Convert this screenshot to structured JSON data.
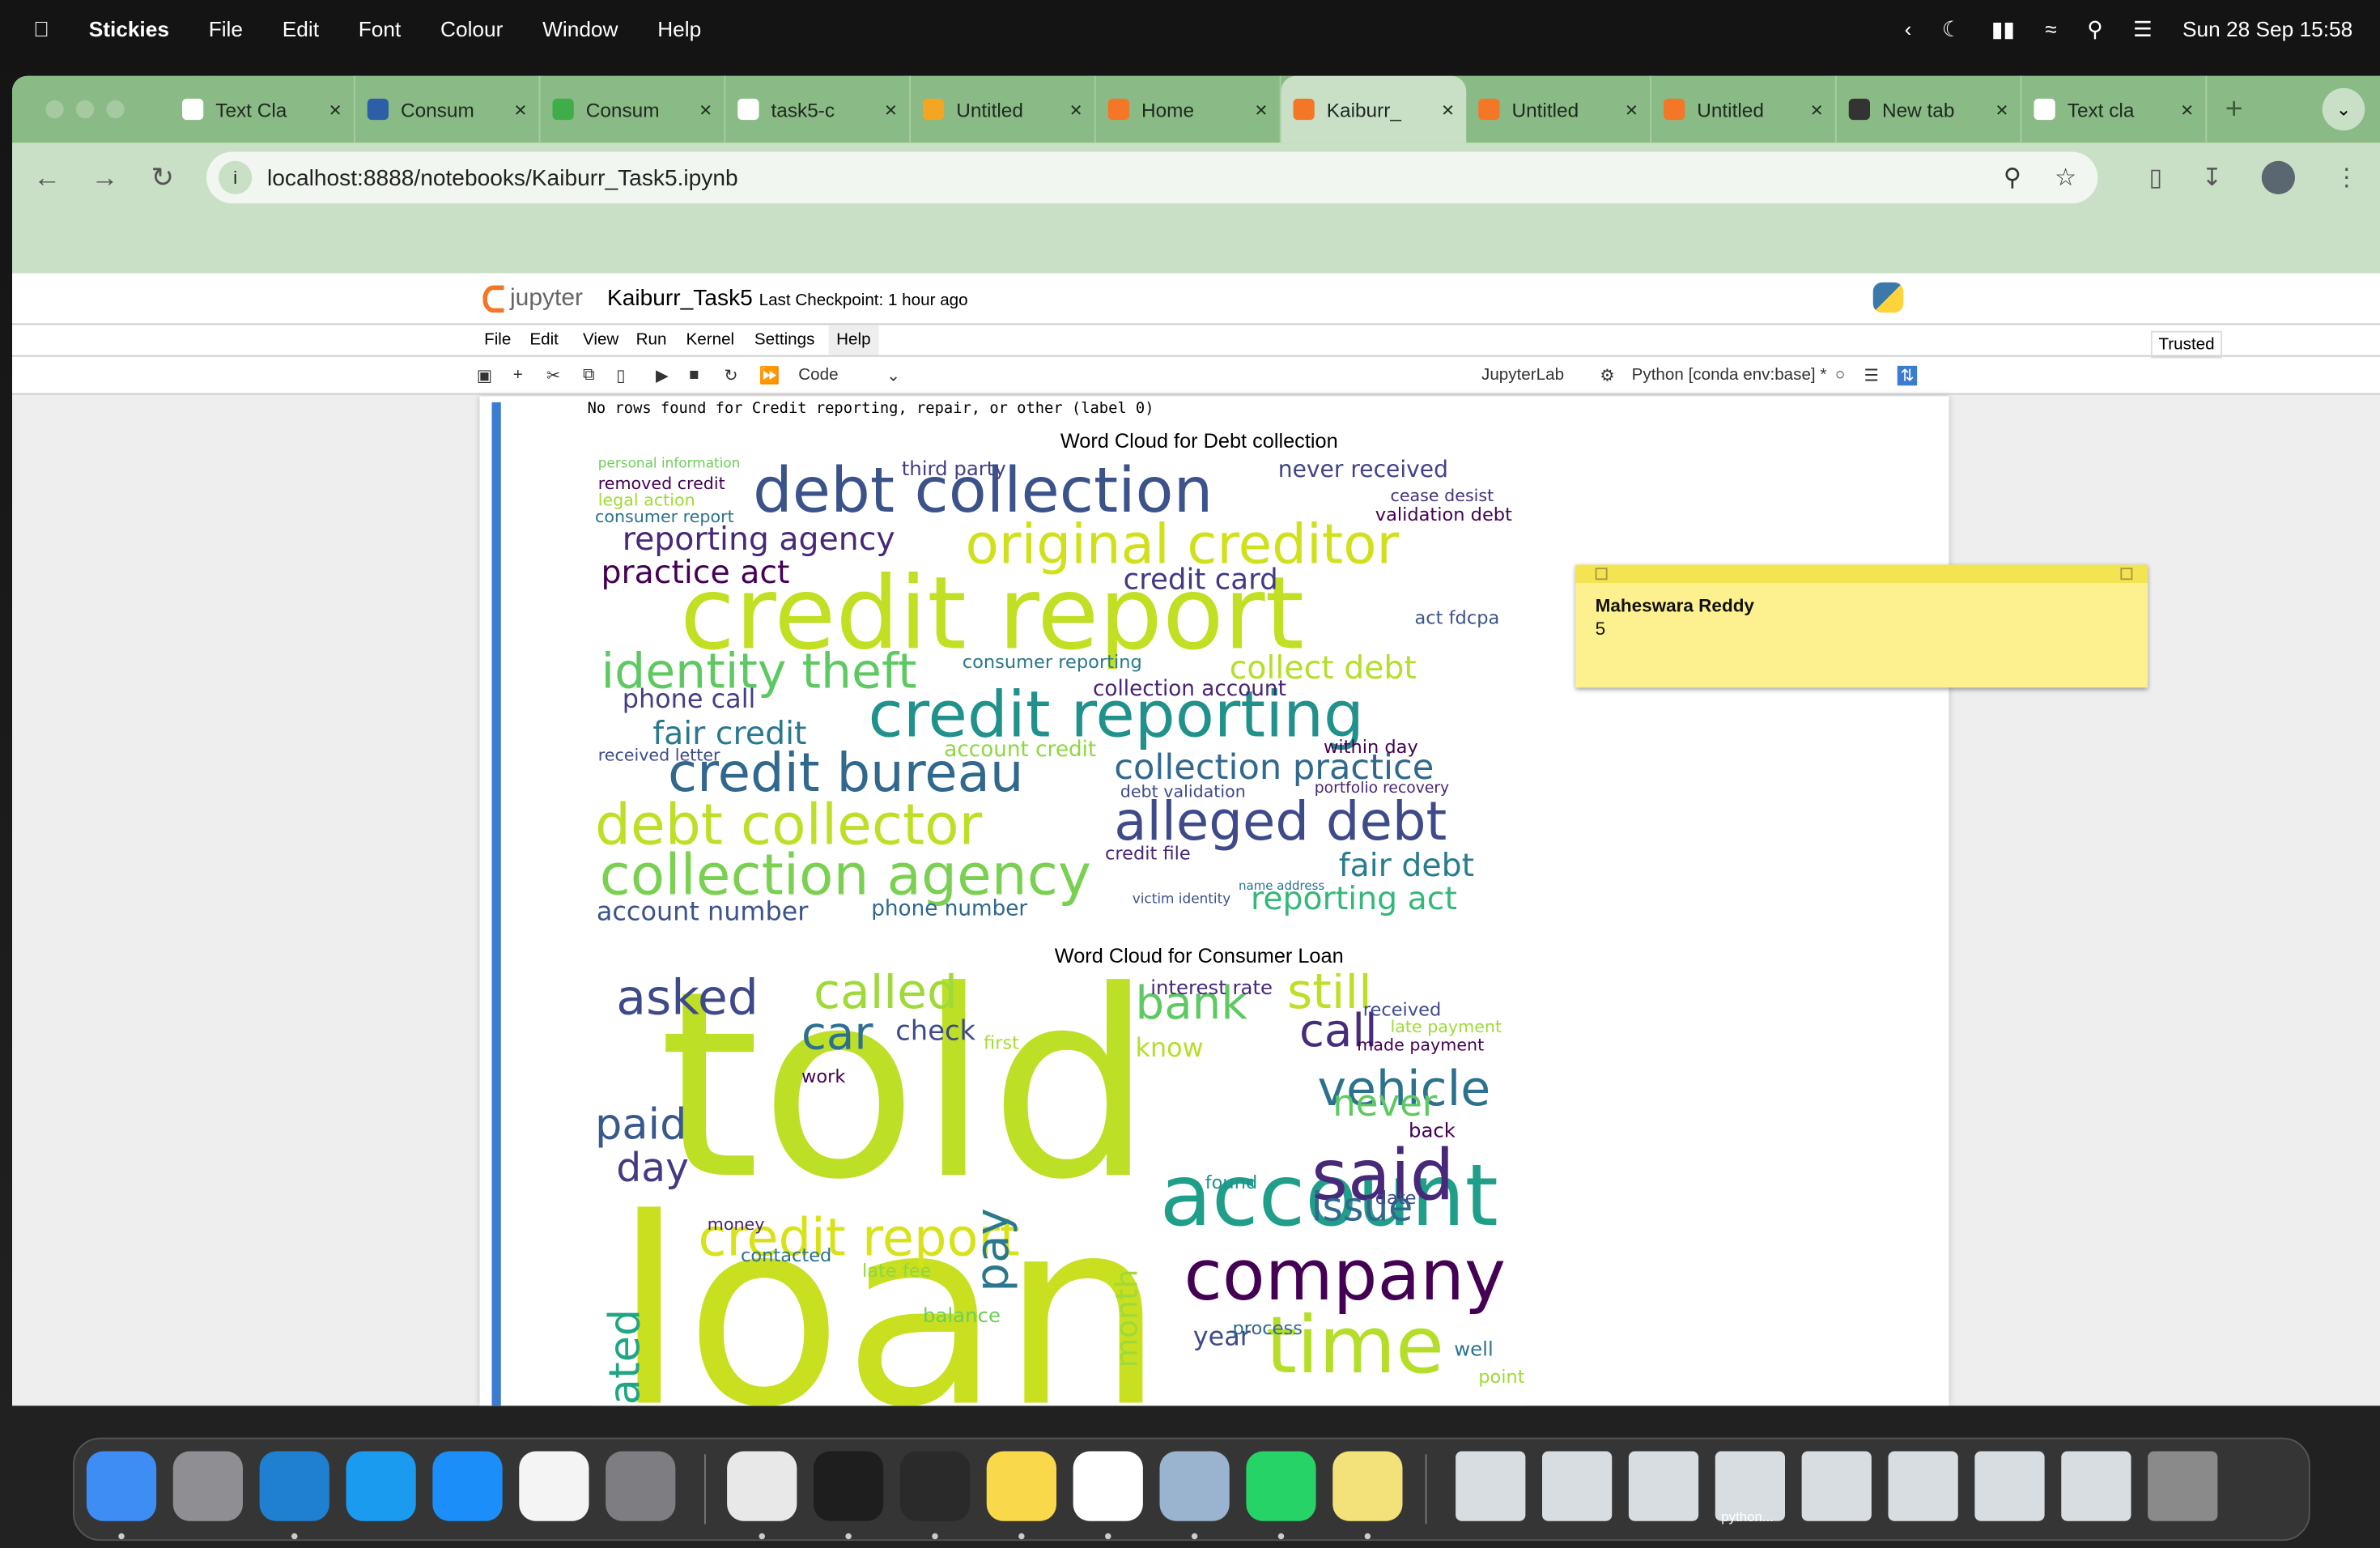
{
  "menubar": {
    "app": "Stickies",
    "items": [
      "File",
      "Edit",
      "Font",
      "Colour",
      "Window",
      "Help"
    ],
    "datetime": "Sun 28 Sep  15:58"
  },
  "tabs": [
    {
      "label": "Text Cla",
      "color": "#ffffff"
    },
    {
      "label": "Consum",
      "color": "#2d5fa8"
    },
    {
      "label": "Consum",
      "color": "#3fae49"
    },
    {
      "label": "task5-c",
      "color": "#ffffff"
    },
    {
      "label": "Untitled",
      "color": "#f4a623"
    },
    {
      "label": "Home",
      "color": "#f37726"
    },
    {
      "label": "Kaiburr_",
      "color": "#f37726"
    },
    {
      "label": "Untitled",
      "color": "#f37726"
    },
    {
      "label": "Untitled",
      "color": "#f37726"
    },
    {
      "label": "New tab",
      "color": "#333333"
    },
    {
      "label": "Text cla",
      "color": "#ffffff"
    }
  ],
  "active_tab": 6,
  "address": "localhost:8888/notebooks/Kaiburr_Task5.ipynb",
  "jupyter": {
    "logo": "jupyter",
    "notebook": "Kaiburr_Task5",
    "checkpoint": "Last Checkpoint: 1 hour ago",
    "menu": [
      "File",
      "Edit",
      "View",
      "Run",
      "Kernel",
      "Settings",
      "Help"
    ],
    "trusted": "Trusted",
    "cell_type": "Code",
    "jupyterlab": "JupyterLab",
    "kernel": "Python [conda env:base] *"
  },
  "output_text": "No rows found for Credit reporting, repair, or other (label 0)",
  "word_clouds": [
    {
      "title": "Word Cloud for Debt collection",
      "words": [
        {
          "text": "debt collection",
          "color": "#3b528b"
        },
        {
          "text": "credit report",
          "color": "#c2df23"
        },
        {
          "text": "original creditor",
          "color": "#d0e11c"
        },
        {
          "text": "reporting agency",
          "color": "#482878"
        },
        {
          "text": "practice act",
          "color": "#440154"
        },
        {
          "text": "identity theft",
          "color": "#5ec962"
        },
        {
          "text": "credit reporting",
          "color": "#21918c"
        },
        {
          "text": "credit bureau",
          "color": "#31688e"
        },
        {
          "text": "collection practice",
          "color": "#31688e"
        },
        {
          "text": "debt collector",
          "color": "#bddf26"
        },
        {
          "text": "alleged debt",
          "color": "#3e4a89"
        },
        {
          "text": "collection agency",
          "color": "#7ad151"
        },
        {
          "text": "fair credit",
          "color": "#2a788e"
        },
        {
          "text": "fair debt",
          "color": "#287c8e"
        },
        {
          "text": "reporting act",
          "color": "#35b779"
        },
        {
          "text": "account number",
          "color": "#3b528b"
        },
        {
          "text": "phone call",
          "color": "#433e85"
        },
        {
          "text": "collect debt",
          "color": "#b5de2b"
        },
        {
          "text": "credit card",
          "color": "#443983"
        },
        {
          "text": "collection account",
          "color": "#482475"
        },
        {
          "text": "never received",
          "color": "#414487"
        },
        {
          "text": "personal information",
          "color": "#6ece58"
        },
        {
          "text": "removed credit",
          "color": "#440154"
        },
        {
          "text": "legal action",
          "color": "#a2da37"
        },
        {
          "text": "consumer report",
          "color": "#2c728e"
        },
        {
          "text": "third party",
          "color": "#433e85"
        },
        {
          "text": "cease desist",
          "color": "#46327e"
        },
        {
          "text": "validation debt",
          "color": "#440154"
        },
        {
          "text": "act fdcpa",
          "color": "#3b528b"
        },
        {
          "text": "consumer reporting",
          "color": "#2a788e"
        },
        {
          "text": "received letter",
          "color": "#3e4a89"
        },
        {
          "text": "account credit",
          "color": "#8fd744"
        },
        {
          "text": "debt validation",
          "color": "#3e4989"
        },
        {
          "text": "credit file",
          "color": "#482878"
        },
        {
          "text": "within day",
          "color": "#440154"
        },
        {
          "text": "phone number",
          "color": "#31688e"
        },
        {
          "text": "portfolio recovery",
          "color": "#482475"
        },
        {
          "text": "name address",
          "color": "#2d708e"
        },
        {
          "text": "victim identity",
          "color": "#3b528b"
        }
      ]
    },
    {
      "title": "Word Cloud for Consumer Loan",
      "words": [
        {
          "text": "told",
          "color": "#bddf26"
        },
        {
          "text": "loan",
          "color": "#c8e020"
        },
        {
          "text": "account",
          "color": "#1f9e89"
        },
        {
          "text": "company",
          "color": "#440154"
        },
        {
          "text": "said",
          "color": "#482878"
        },
        {
          "text": "vehicle",
          "color": "#2c728e"
        },
        {
          "text": "asked",
          "color": "#3e4989"
        },
        {
          "text": "called",
          "color": "#a0da39"
        },
        {
          "text": "car",
          "color": "#2d708e"
        },
        {
          "text": "bank",
          "color": "#5ec962"
        },
        {
          "text": "still",
          "color": "#bddf26"
        },
        {
          "text": "call",
          "color": "#472c7a"
        },
        {
          "text": "paid",
          "color": "#38598c"
        },
        {
          "text": "day",
          "color": "#443a83"
        },
        {
          "text": "credit report",
          "color": "#d8e219"
        },
        {
          "text": "never",
          "color": "#5ec962"
        },
        {
          "text": "time",
          "color": "#b5de2b"
        },
        {
          "text": "issue",
          "color": "#31688e"
        },
        {
          "text": "stated",
          "color": "#21a685"
        },
        {
          "text": "pay",
          "color": "#2a788e"
        },
        {
          "text": "check",
          "color": "#3e4a89"
        },
        {
          "text": "year",
          "color": "#3e4a89"
        },
        {
          "text": "interest rate",
          "color": "#482878"
        },
        {
          "text": "know",
          "color": "#b5de2b"
        },
        {
          "text": "received",
          "color": "#3e4a89"
        },
        {
          "text": "made payment",
          "color": "#440154"
        },
        {
          "text": "late payment",
          "color": "#a0da39"
        },
        {
          "text": "back",
          "color": "#440154"
        },
        {
          "text": "contacted",
          "color": "#2c728e"
        },
        {
          "text": "money",
          "color": "#482475"
        },
        {
          "text": "late fee",
          "color": "#90d743"
        },
        {
          "text": "balance",
          "color": "#6ece58"
        },
        {
          "text": "process",
          "color": "#31688e"
        },
        {
          "text": "well",
          "color": "#2c728e"
        },
        {
          "text": "point",
          "color": "#a2da37"
        },
        {
          "text": "found",
          "color": "#21918c"
        },
        {
          "text": "month",
          "color": "#9fda3a"
        },
        {
          "text": "work",
          "color": "#440154"
        },
        {
          "text": "first",
          "color": "#a8db34"
        },
        {
          "text": "date",
          "color": "#3e4a89"
        }
      ]
    }
  ],
  "sticky": {
    "title": "Maheswara Reddy",
    "body": "5"
  },
  "dock": [
    {
      "name": "finder",
      "color": "#3d8df5"
    },
    {
      "name": "launchpad",
      "color": "#8e8e93"
    },
    {
      "name": "vscode",
      "color": "#1f7fd1"
    },
    {
      "name": "safari",
      "color": "#1a9bf0"
    },
    {
      "name": "app-store",
      "color": "#1c8ef9"
    },
    {
      "name": "reminders",
      "color": "#f4f4f4"
    },
    {
      "name": "system-settings",
      "color": "#7d7d82"
    },
    {
      "name": "chrome",
      "color": "#e8e8e8"
    },
    {
      "name": "terminal",
      "color": "#1e1e1e"
    },
    {
      "name": "activity",
      "color": "#2a2a2a"
    },
    {
      "name": "notes",
      "color": "#f9d949"
    },
    {
      "name": "freeform",
      "color": "#ffffff"
    },
    {
      "name": "preview",
      "color": "#9ab4cf"
    },
    {
      "name": "whatsapp",
      "color": "#25d366"
    },
    {
      "name": "stickies",
      "color": "#f3e27a"
    }
  ],
  "dock_recent_label": "python..."
}
